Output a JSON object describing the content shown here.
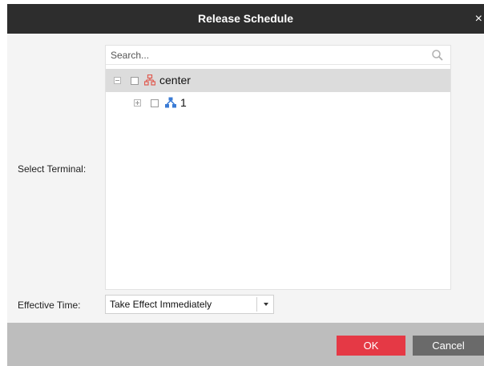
{
  "dialog": {
    "title": "Release Schedule",
    "close_symbol": "×"
  },
  "form": {
    "select_terminal_label": "Select Terminal:",
    "effective_time_label": "Effective Time:"
  },
  "tree": {
    "search_placeholder": "Search...",
    "nodes": [
      {
        "label": "center",
        "icon": "organization-icon",
        "expanded": true,
        "checked": false,
        "selected": true
      },
      {
        "label": "1",
        "icon": "network-node-icon",
        "expanded": false,
        "checked": false,
        "selected": false
      }
    ]
  },
  "effective_time": {
    "value": "Take Effect Immediately"
  },
  "buttons": {
    "ok": "OK",
    "cancel": "Cancel"
  },
  "colors": {
    "title_bar": "#2d2d2d",
    "ok_button": "#e53945",
    "cancel_button": "#6a6a6a",
    "footer": "#bdbdbd",
    "organization_icon": "#e05a4f",
    "network_node_icon": "#3a7bd5"
  }
}
